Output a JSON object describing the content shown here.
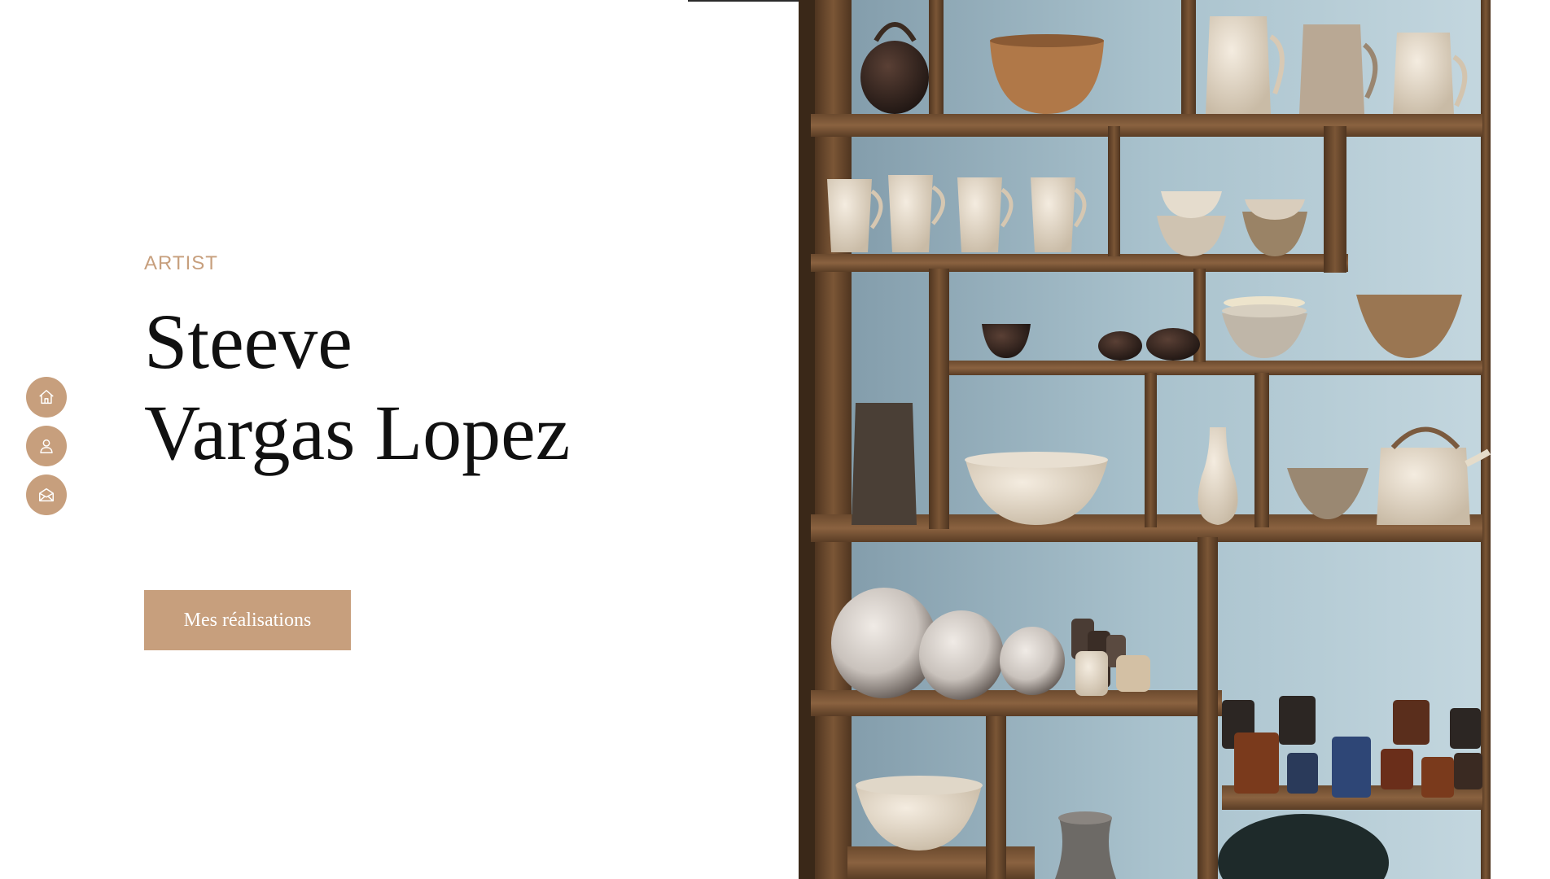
{
  "hero": {
    "eyebrow": "ARTIST",
    "name_line1": "Steeve",
    "name_line2": "Vargas Lopez",
    "cta_label": "Mes réalisations"
  },
  "side_nav": {
    "items": [
      {
        "icon": "home-icon"
      },
      {
        "icon": "user-icon"
      },
      {
        "icon": "mail-icon"
      }
    ]
  },
  "photo": {
    "subject": "wooden shelving with ceramic pottery"
  },
  "colors": {
    "accent": "#c79f7d",
    "text": "#111111",
    "background": "#ffffff"
  }
}
